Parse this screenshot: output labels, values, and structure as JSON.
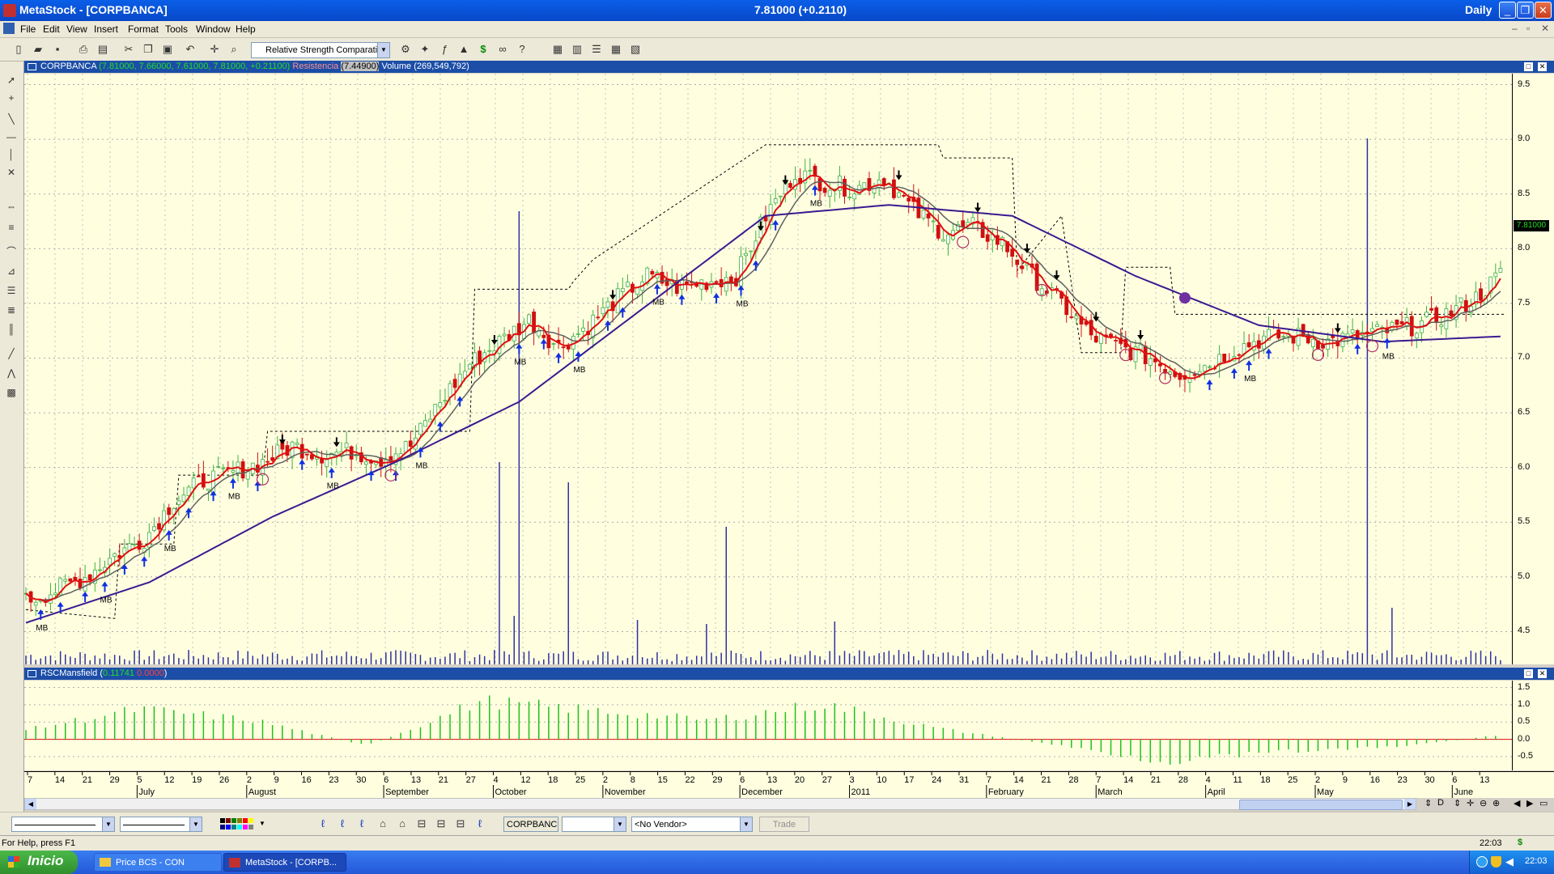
{
  "window": {
    "title": "MetaStock - [CORPBANCA]",
    "center_readout": "7.81000 (+0.2110)",
    "periodicity": "Daily"
  },
  "menu": [
    "File",
    "Edit",
    "View",
    "Insert",
    "Format",
    "Tools",
    "Window",
    "Help"
  ],
  "toolbar": {
    "explorer_combo": "Relative Strength Comparati"
  },
  "price_pane": {
    "header_title": "CORPBANCA",
    "header_values": "(7.81000, 7.66000, 7.61000, 7.81000, +0.21100)",
    "resistance_label": "Resistencia",
    "resistance_value": "(7.44900)",
    "volume_label": "Volume",
    "volume_value": "(269,549,792)",
    "last_price_tag": "7.81000",
    "y_ticks": [
      "9.5",
      "9.0",
      "8.5",
      "8.0",
      "7.5",
      "7.0",
      "6.5",
      "6.0",
      "5.5",
      "5.0",
      "4.5"
    ],
    "signal_label": "MB"
  },
  "indicator_pane": {
    "header_title": "RSCMansfield",
    "header_value1": "0.11741",
    "header_value2": "0.0000",
    "y_ticks": [
      "1.5",
      "1.0",
      "0.5",
      "0.0",
      "-0.5"
    ]
  },
  "date_axis": {
    "day_ticks": [
      "7",
      "14",
      "21",
      "29",
      "5",
      "12",
      "19",
      "26",
      "2",
      "9",
      "16",
      "23",
      "30",
      "6",
      "13",
      "21",
      "27",
      "4",
      "12",
      "18",
      "25",
      "2",
      "8",
      "15",
      "22",
      "29",
      "6",
      "13",
      "20",
      "27",
      "3",
      "10",
      "17",
      "24",
      "31",
      "7",
      "14",
      "21",
      "28",
      "7",
      "14",
      "21",
      "28",
      "4",
      "11",
      "18",
      "25",
      "2",
      "9",
      "16",
      "23",
      "30",
      "6",
      "13"
    ],
    "month_labels": [
      "July",
      "August",
      "September",
      "October",
      "November",
      "December",
      "2011",
      "February",
      "March",
      "April",
      "May",
      "June"
    ]
  },
  "bottom_toolbar": {
    "symbol": "CORPBANC",
    "vendor": "<No Vendor>",
    "trade_button": "Trade"
  },
  "status": {
    "help_text": "For Help, press F1",
    "time": "22:03",
    "currency_icon": "$"
  },
  "taskbar": {
    "start_label": "Inicio",
    "tasks": [
      "Price BCS - CON",
      "MetaStock - [CORPB..."
    ],
    "clock": "22:03"
  },
  "chart_data": [
    {
      "type": "candlestick",
      "title": "CORPBANCA",
      "ylim": [
        4.2,
        9.6
      ],
      "close_points": [
        [
          "Jul 7",
          4.78
        ],
        [
          "Jul 14",
          4.88
        ],
        [
          "Jul 21",
          5.0
        ],
        [
          "Jul 29",
          5.2
        ],
        [
          "Aug 5",
          5.35
        ],
        [
          "Aug 12",
          5.7
        ],
        [
          "Aug 19",
          5.88
        ],
        [
          "Aug 26",
          5.96
        ],
        [
          "Sep 2",
          6.05
        ],
        [
          "Sep 9",
          6.2
        ],
        [
          "Sep 16",
          6.12
        ],
        [
          "Sep 23",
          6.15
        ],
        [
          "Sep 30",
          6.08
        ],
        [
          "Oct 6",
          6.2
        ],
        [
          "Oct 13",
          6.6
        ],
        [
          "Oct 21",
          6.95
        ],
        [
          "Oct 27",
          7.15
        ],
        [
          "Nov 4",
          7.35
        ],
        [
          "Nov 12",
          7.1
        ],
        [
          "Nov 18",
          7.3
        ],
        [
          "Nov 25",
          7.55
        ],
        [
          "Dec 2",
          7.75
        ],
        [
          "Dec 8",
          7.65
        ],
        [
          "Dec 15",
          7.7
        ],
        [
          "Dec 22",
          7.75
        ],
        [
          "Dec 29",
          8.3
        ],
        [
          "Jan 6",
          8.7
        ],
        [
          "Jan 13",
          8.6
        ],
        [
          "Jan 20",
          8.55
        ],
        [
          "Jan 27",
          8.65
        ],
        [
          "Feb 3",
          8.35
        ],
        [
          "Feb 10",
          8.15
        ],
        [
          "Feb 17",
          8.2
        ],
        [
          "Feb 24",
          8.05
        ],
        [
          "Mar 3",
          7.75
        ],
        [
          "Mar 10",
          7.5
        ],
        [
          "Mar 17",
          7.2
        ],
        [
          "Mar 24",
          7.1
        ],
        [
          "Mar 31",
          7.0
        ],
        [
          "Apr 7",
          6.85
        ],
        [
          "Apr 14",
          6.95
        ],
        [
          "Apr 21",
          7.1
        ],
        [
          "Apr 28",
          7.2
        ],
        [
          "May 4",
          7.2
        ],
        [
          "May 11",
          7.15
        ],
        [
          "May 18",
          7.2
        ],
        [
          "May 25",
          7.25
        ],
        [
          "Jun 2",
          7.3
        ],
        [
          "Jun 9",
          7.4
        ],
        [
          "Jun 16",
          7.55
        ],
        [
          "Jun 23",
          7.81
        ]
      ],
      "moving_average_long": [
        [
          "Jul 7",
          4.58
        ],
        [
          "Aug 12",
          4.95
        ],
        [
          "Sep 16",
          5.55
        ],
        [
          "Oct 21",
          6.05
        ],
        [
          "Nov 25",
          6.6
        ],
        [
          "Dec 29",
          7.45
        ],
        [
          "Feb 3",
          8.3
        ],
        [
          "Feb 24",
          8.4
        ],
        [
          "Mar 17",
          8.3
        ],
        [
          "Apr 14",
          7.75
        ],
        [
          "May 4",
          7.3
        ],
        [
          "May 25",
          7.15
        ],
        [
          "Jun 23",
          7.2
        ]
      ]
    },
    {
      "type": "bar",
      "title": "RSCMansfield",
      "ylim": [
        -0.9,
        1.7
      ],
      "values_description_points": [
        [
          "Jul 7",
          0.3
        ],
        [
          "Aug 12",
          0.95
        ],
        [
          "Sep 16",
          0.6
        ],
        [
          "Oct 6",
          -0.2
        ],
        [
          "Oct 27",
          1.2
        ],
        [
          "Nov 18",
          0.9
        ],
        [
          "Dec 15",
          0.6
        ],
        [
          "Jan 13",
          1.1
        ],
        [
          "Feb 10",
          0.35
        ],
        [
          "Mar 3",
          -0.15
        ],
        [
          "Apr 7",
          -0.7
        ],
        [
          "May 4",
          -0.4
        ],
        [
          "Jun 2",
          -0.25
        ],
        [
          "Jun 23",
          0.15
        ]
      ]
    }
  ]
}
